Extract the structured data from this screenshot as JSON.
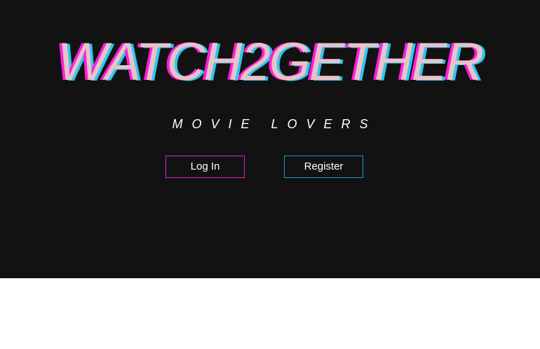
{
  "hero": {
    "logo_text": "WATCH2GETHER",
    "tagline": "MOVIE LOVERS"
  },
  "actions": {
    "login_label": "Log In",
    "register_label": "Register"
  },
  "colors": {
    "background": "#121212",
    "logo_fill": "#e8c3c8",
    "logo_magenta_shadow": "#ff1fd8",
    "logo_cyan_shadow": "#2fc7ee",
    "login_border": "#e21fd0",
    "register_border": "#1c9ec2"
  }
}
